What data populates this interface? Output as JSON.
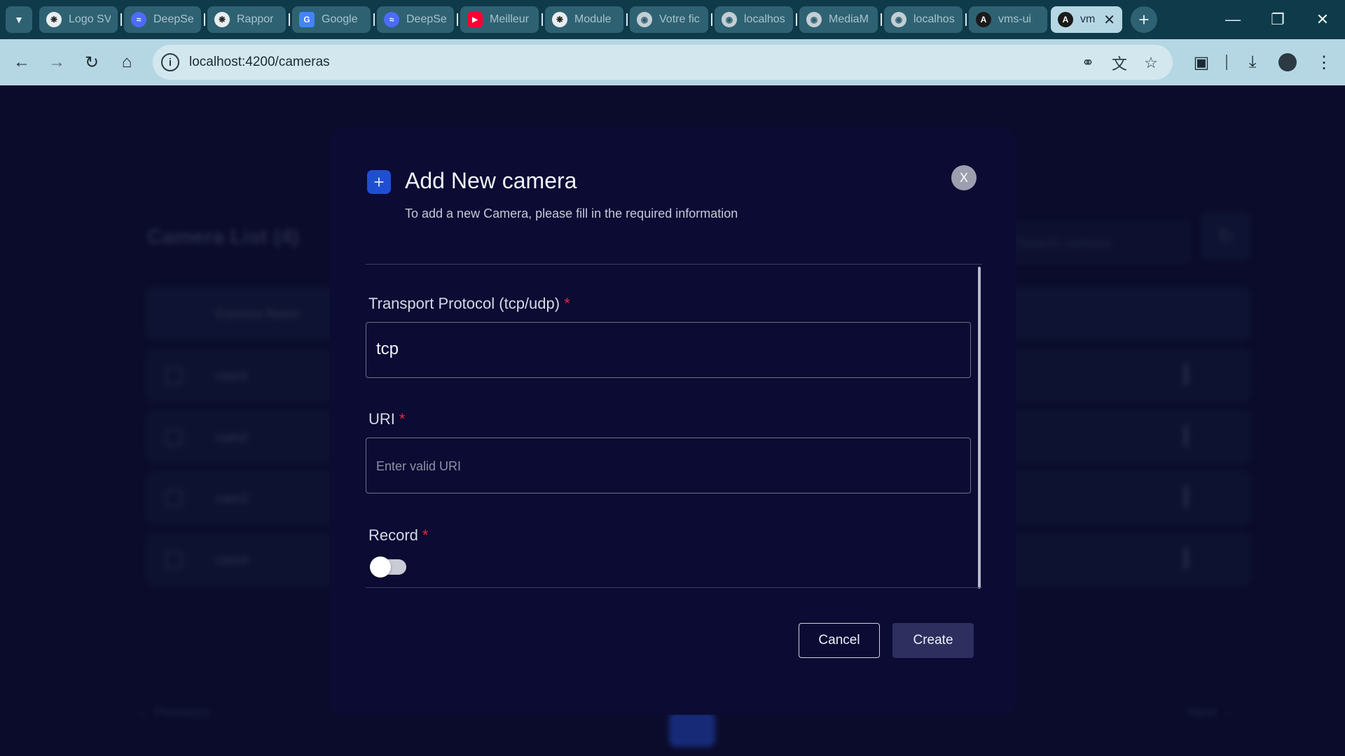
{
  "browser": {
    "tabs": [
      {
        "title": "Logo SV",
        "icon": "openai-icon"
      },
      {
        "title": "DeepSe",
        "icon": "deepseek-icon"
      },
      {
        "title": "Rappor",
        "icon": "openai-icon"
      },
      {
        "title": "Google",
        "icon": "google-translate-icon"
      },
      {
        "title": "DeepSe",
        "icon": "deepseek-icon"
      },
      {
        "title": "Meilleur",
        "icon": "youtube-icon"
      },
      {
        "title": "Module",
        "icon": "openai-icon"
      },
      {
        "title": "Votre fic",
        "icon": "globe-icon"
      },
      {
        "title": "localhos",
        "icon": "globe-icon"
      },
      {
        "title": "MediaM",
        "icon": "globe-icon"
      },
      {
        "title": "localhos",
        "icon": "globe-icon"
      },
      {
        "title": "vms-ui",
        "icon": "angular-icon"
      },
      {
        "title": "vm",
        "icon": "angular-icon",
        "active": true
      }
    ],
    "url": "localhost:4200/cameras",
    "colors": {
      "tabbar": "#0e3a4a",
      "toolbar": "#b5d7e3"
    }
  },
  "background_page": {
    "title": "Camera List (4)",
    "search_placeholder": "Search camera",
    "column_header": "Camera Name",
    "rows": [
      "cam1",
      "cam2",
      "cam3",
      "cam4"
    ],
    "pagination": {
      "previous": "Previous",
      "next": "Next"
    }
  },
  "modal": {
    "title": "Add New camera",
    "subtitle": "To add a new Camera, please fill in the required information",
    "close_label": "X",
    "fields": {
      "transport": {
        "label": "Transport Protocol (tcp/udp)",
        "required_mark": "*",
        "value": "tcp"
      },
      "uri": {
        "label": "URI",
        "required_mark": "*",
        "placeholder": "Enter valid URI",
        "value": ""
      },
      "record": {
        "label": "Record",
        "required_mark": "*",
        "enabled": false
      }
    },
    "buttons": {
      "cancel": "Cancel",
      "create": "Create"
    },
    "colors": {
      "background": "#0b0b33",
      "accent": "#1f4fd0",
      "required": "#e0283c"
    }
  }
}
